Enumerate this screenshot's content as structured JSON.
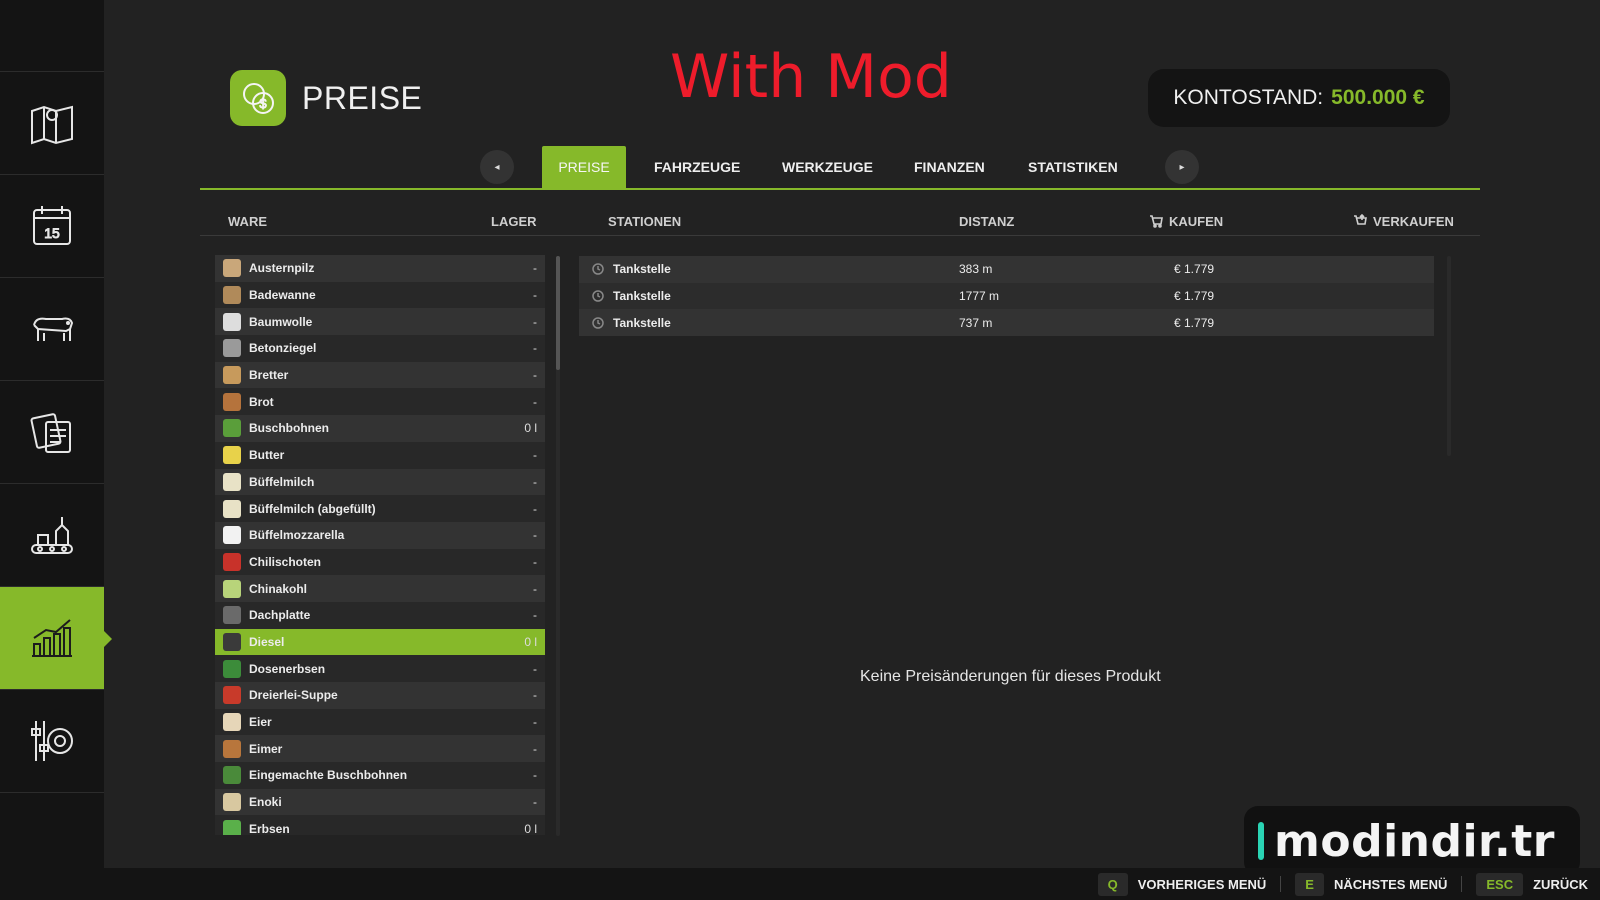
{
  "sidebar": {
    "items": [
      {
        "icon": "map-icon"
      },
      {
        "icon": "calendar-icon",
        "day": "15"
      },
      {
        "icon": "cow-icon"
      },
      {
        "icon": "contracts-icon"
      },
      {
        "icon": "production-icon"
      },
      {
        "icon": "stats-chart-icon",
        "active": true
      },
      {
        "icon": "settings-icon"
      }
    ]
  },
  "header": {
    "title": "PREISE",
    "icon": "money-coins-icon",
    "overlay_caption": "With Mod",
    "balance_label": "KONTOSTAND:",
    "balance_value": "500.000 €"
  },
  "tabs": {
    "prev_icon": "◂",
    "next_icon": "▸",
    "items": [
      "PREISE",
      "FAHRZEUGE",
      "WERKZEUGE",
      "FINANZEN",
      "STATISTIKEN"
    ],
    "active": "PREISE"
  },
  "columns": {
    "ware": "WARE",
    "lager": "LAGER",
    "stationen": "STATIONEN",
    "distanz": "DISTANZ",
    "kaufen": "KAUFEN",
    "verkaufen": "VERKAUFEN"
  },
  "products": [
    {
      "name": "Austernpilz",
      "stock": "-",
      "color": "#c9a77a"
    },
    {
      "name": "Badewanne",
      "stock": "-",
      "color": "#b08a5a"
    },
    {
      "name": "Baumwolle",
      "stock": "-",
      "color": "#dddddd"
    },
    {
      "name": "Betonziegel",
      "stock": "-",
      "color": "#9a9a9a"
    },
    {
      "name": "Bretter",
      "stock": "-",
      "color": "#c79a5c"
    },
    {
      "name": "Brot",
      "stock": "-",
      "color": "#b5733c"
    },
    {
      "name": "Buschbohnen",
      "stock": "0 l",
      "color": "#5a9e3a"
    },
    {
      "name": "Butter",
      "stock": "-",
      "color": "#e8d24a"
    },
    {
      "name": "Büffelmilch",
      "stock": "-",
      "color": "#e8e2c6"
    },
    {
      "name": "Büffelmilch (abgefüllt)",
      "stock": "-",
      "color": "#e8e2c6"
    },
    {
      "name": "Büffelmozzarella",
      "stock": "-",
      "color": "#f2f2f2"
    },
    {
      "name": "Chilischoten",
      "stock": "-",
      "color": "#c8322a"
    },
    {
      "name": "Chinakohl",
      "stock": "-",
      "color": "#b8d47a"
    },
    {
      "name": "Dachplatte",
      "stock": "-",
      "color": "#6a6a6a"
    },
    {
      "name": "Diesel",
      "stock": "0 l",
      "color": "#3a3a3a",
      "selected": true
    },
    {
      "name": "Dosenerbsen",
      "stock": "-",
      "color": "#3c8c3a"
    },
    {
      "name": "Dreierlei-Suppe",
      "stock": "-",
      "color": "#c83a2a"
    },
    {
      "name": "Eier",
      "stock": "-",
      "color": "#e6d6b8"
    },
    {
      "name": "Eimer",
      "stock": "-",
      "color": "#b8763c"
    },
    {
      "name": "Eingemachte Buschbohnen",
      "stock": "-",
      "color": "#4a8a3a"
    },
    {
      "name": "Enoki",
      "stock": "-",
      "color": "#d8c8a0"
    },
    {
      "name": "Erbsen",
      "stock": "0 l",
      "color": "#5ab04a"
    }
  ],
  "stations": [
    {
      "name": "Tankstelle",
      "distance": "383 m",
      "buy": "€ 1.779"
    },
    {
      "name": "Tankstelle",
      "distance": "1777 m",
      "buy": "€ 1.779"
    },
    {
      "name": "Tankstelle",
      "distance": "737 m",
      "buy": "€ 1.779"
    }
  ],
  "empty_message": "Keine Preisänderungen für dieses Produkt",
  "watermark": "modindir.tr",
  "footer": [
    {
      "key": "Q",
      "label": "VORHERIGES MENÜ"
    },
    {
      "key": "E",
      "label": "NÄCHSTES MENÜ"
    },
    {
      "key": "ESC",
      "label": "ZURÜCK"
    }
  ],
  "colors": {
    "accent": "#86b92a",
    "caption": "#ee1c2b",
    "watermark_bar": "#2ad4b4"
  }
}
